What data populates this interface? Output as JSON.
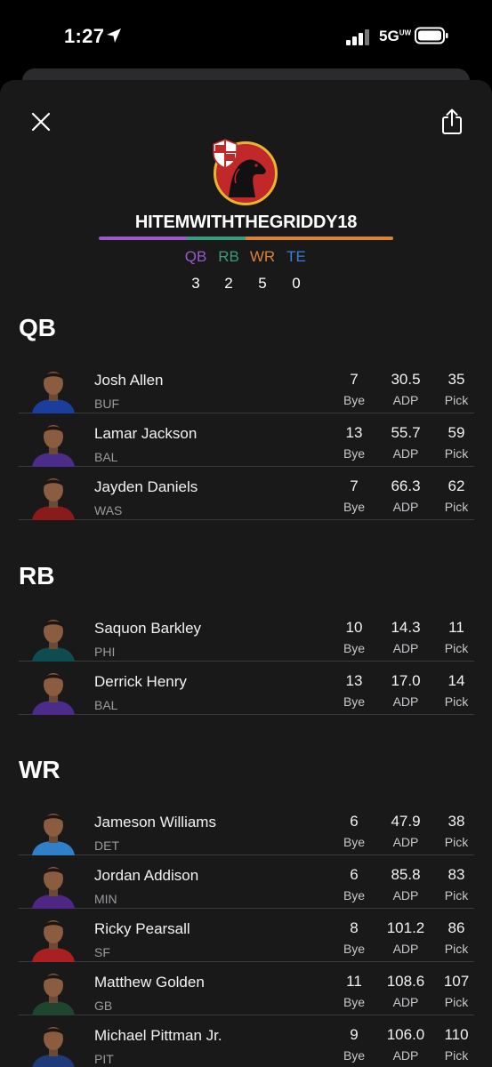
{
  "status_bar": {
    "time": "1:27",
    "network": "5G",
    "network_sup": "UW"
  },
  "header": {
    "username": "HITEMWITHTHEGRIDDY18"
  },
  "colors": {
    "qb": "#9b59c9",
    "rb": "#3e9a7e",
    "wr": "#d9833a",
    "te": "#3b7fd1"
  },
  "position_counts": [
    {
      "label": "QB",
      "count": "3"
    },
    {
      "label": "RB",
      "count": "2"
    },
    {
      "label": "WR",
      "count": "5"
    },
    {
      "label": "TE",
      "count": "0"
    }
  ],
  "stat_labels": {
    "bye": "Bye",
    "adp": "ADP",
    "pick": "Pick"
  },
  "sections": [
    {
      "title": "QB",
      "players": [
        {
          "name": "Josh Allen",
          "team": "BUF",
          "bye": "7",
          "adp": "30.5",
          "pick": "35",
          "jersey": "#1b3e9e"
        },
        {
          "name": "Lamar Jackson",
          "team": "BAL",
          "bye": "13",
          "adp": "55.7",
          "pick": "59",
          "jersey": "#4b2c8a"
        },
        {
          "name": "Jayden Daniels",
          "team": "WAS",
          "bye": "7",
          "adp": "66.3",
          "pick": "62",
          "jersey": "#8b1a1a"
        }
      ]
    },
    {
      "title": "RB",
      "players": [
        {
          "name": "Saquon Barkley",
          "team": "PHI",
          "bye": "10",
          "adp": "14.3",
          "pick": "11",
          "jersey": "#0e4c4f"
        },
        {
          "name": "Derrick Henry",
          "team": "BAL",
          "bye": "13",
          "adp": "17.0",
          "pick": "14",
          "jersey": "#4b2c8a"
        }
      ]
    },
    {
      "title": "WR",
      "players": [
        {
          "name": "Jameson Williams",
          "team": "DET",
          "bye": "6",
          "adp": "47.9",
          "pick": "38",
          "jersey": "#2f7fc9"
        },
        {
          "name": "Jordan Addison",
          "team": "MIN",
          "bye": "6",
          "adp": "85.8",
          "pick": "83",
          "jersey": "#4f2683"
        },
        {
          "name": "Ricky Pearsall",
          "team": "SF",
          "bye": "8",
          "adp": "101.2",
          "pick": "86",
          "jersey": "#aa1f1f"
        },
        {
          "name": "Matthew Golden",
          "team": "GB",
          "bye": "11",
          "adp": "108.6",
          "pick": "107",
          "jersey": "#20452f"
        },
        {
          "name": "Michael Pittman Jr.",
          "team": "PIT",
          "bye": "9",
          "adp": "106.0",
          "pick": "110",
          "jersey": "#1e3a7a"
        }
      ]
    }
  ]
}
